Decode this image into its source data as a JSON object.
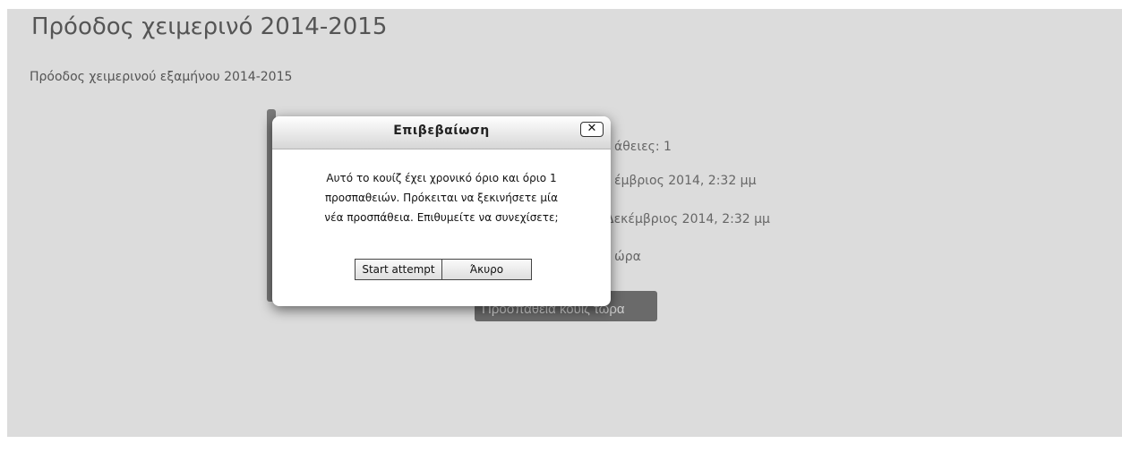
{
  "page": {
    "title": "Πρόοδος χειμερινό 2014-2015",
    "intro": "Πρόοδος χειμερινού εξαμήνου 2014-2015"
  },
  "quiz_info": {
    "attempts_fragment": "άθειες: 1",
    "open_fragment": "έμβριος 2014, 2:32 μμ",
    "close_fragment": "Δεκέμβριος 2014, 2:32 μμ",
    "time_limit_fragment": "ώρα",
    "attempt_button_fragment": "Προσπαθεια κουίζ τώρα"
  },
  "dialog": {
    "title": "Επιβεβαίωση",
    "close_symbol": "✕",
    "message_lines": [
      "Αυτό το κουίζ έχει χρονικό όριο και όριο 1",
      "προσπαθειών. Πρόκειται να ξεκινήσετε μία",
      "νέα προσπάθεια. Επιθυμείτε να συνεχίσετε;"
    ],
    "start_label": "Start attempt",
    "cancel_label": "Άκυρο"
  },
  "colors": {
    "page_background": "#dcdcdc",
    "attempt_button": "#6a6a6a",
    "dialog_background": "#ffffff"
  }
}
